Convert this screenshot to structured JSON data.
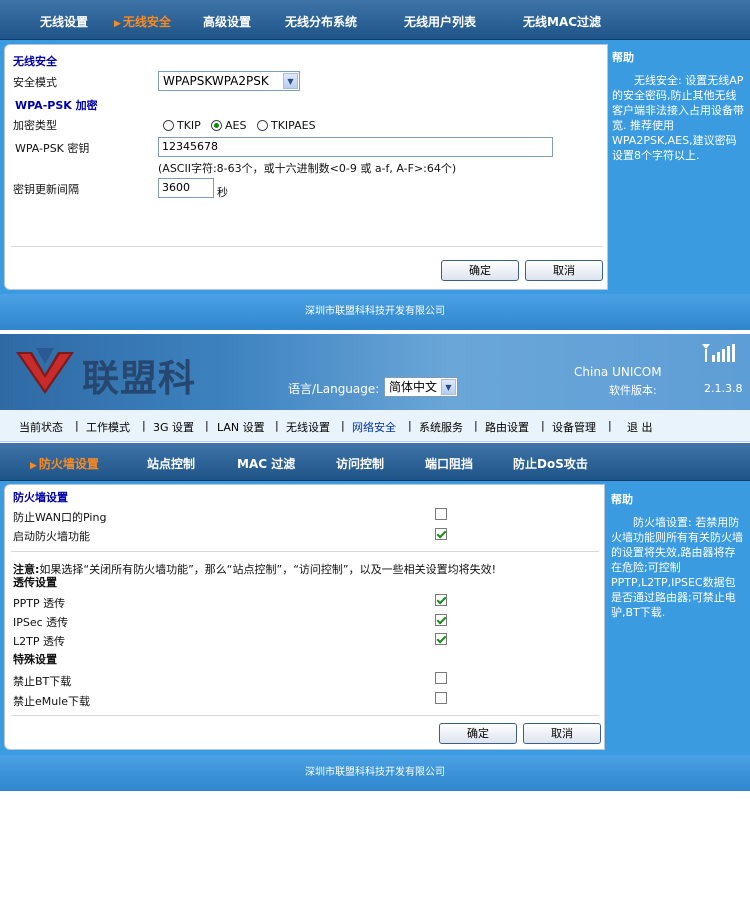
{
  "top": {
    "tabs": [
      {
        "label": "无线设置",
        "active": false
      },
      {
        "label": "无线安全",
        "active": true
      },
      {
        "label": "高级设置",
        "active": false
      },
      {
        "label": "无线分布系统",
        "active": false
      },
      {
        "label": "无线用户列表",
        "active": false
      },
      {
        "label": "无线MAC过滤",
        "active": false
      }
    ],
    "section_title": "无线安全",
    "security_mode_label": "安全模式",
    "security_mode_value": "WPAPSKWPA2PSK",
    "wpa_title": "WPA-PSK 加密",
    "encryption_label": "加密类型",
    "enc_options": [
      "TKIP",
      "AES",
      "TKIPAES"
    ],
    "enc_selected": "AES",
    "key_label": "WPA-PSK 密钥",
    "key_value": "12345678",
    "key_hint": "(ASCII字符:8-63个，或十六进制数<0-9 或  a-f, A-F>:64个)",
    "renew_label": "密钥更新间隔",
    "renew_value": "3600",
    "renew_unit": "秒",
    "ok_label": "确定",
    "cancel_label": "取消",
    "help_title": "帮助",
    "help_body": "无线安全: 设置无线AP的安全密码,防止其他无线客户端非法接入占用设备带宽. 推荐使用WPA2PSK,AES,建议密码设置8个字符以上.",
    "footer": "深圳市联盟科科技开发有限公司"
  },
  "header": {
    "logo_text": "联盟科",
    "language_label": "语言/Language:",
    "language_value": "简体中文",
    "brand": "China UNICOM",
    "version_label": "软件版本:",
    "version_value": "2.1.3.8",
    "signal_icon": "signal-bars-icon"
  },
  "nav": {
    "items": [
      "当前状态",
      "工作模式",
      "3G 设置",
      "LAN 设置",
      "无线设置",
      "网络安全",
      "系统服务",
      "路由设置",
      "设备管理",
      "退 出"
    ],
    "selected": "网络安全"
  },
  "bottom": {
    "tabs": [
      {
        "label": "防火墙设置",
        "active": true
      },
      {
        "label": "站点控制",
        "active": false
      },
      {
        "label": "MAC 过滤",
        "active": false
      },
      {
        "label": "访问控制",
        "active": false
      },
      {
        "label": "端口阻挡",
        "active": false
      },
      {
        "label": "防止DoS攻击",
        "active": false
      }
    ],
    "firewall_title": "防火墙设置",
    "ping_label": "防止WAN口的Ping",
    "ping_checked": false,
    "enable_label": "启动防火墙功能",
    "enable_checked": true,
    "note_bold": "注意:",
    "note_text": "如果选择“关闭所有防火墙功能”，那么“站点控制”，“访问控制”，以及一些相关设置均将失效!",
    "pass_title": "透传设置",
    "pptp_label": "PPTP 透传",
    "pptp_checked": true,
    "ipsec_label": "IPSec 透传",
    "ipsec_checked": true,
    "l2tp_label": "L2TP 透传",
    "l2tp_checked": true,
    "special_title": "特殊设置",
    "bt_label": "禁止BT下载",
    "bt_checked": false,
    "emule_label": "禁止eMule下载",
    "emule_checked": false,
    "ok_label": "确定",
    "cancel_label": "取消",
    "help_title": "帮助",
    "help_body": "防火墙设置: 若禁用防火墙功能则所有有关防火墙的设置将失效,路由器将存在危险;可控制PPTP,L2TP,IPSEC数据包是否通过路由器;可禁止电驴,BT下载.",
    "footer": "深圳市联盟科科技开发有限公司"
  }
}
